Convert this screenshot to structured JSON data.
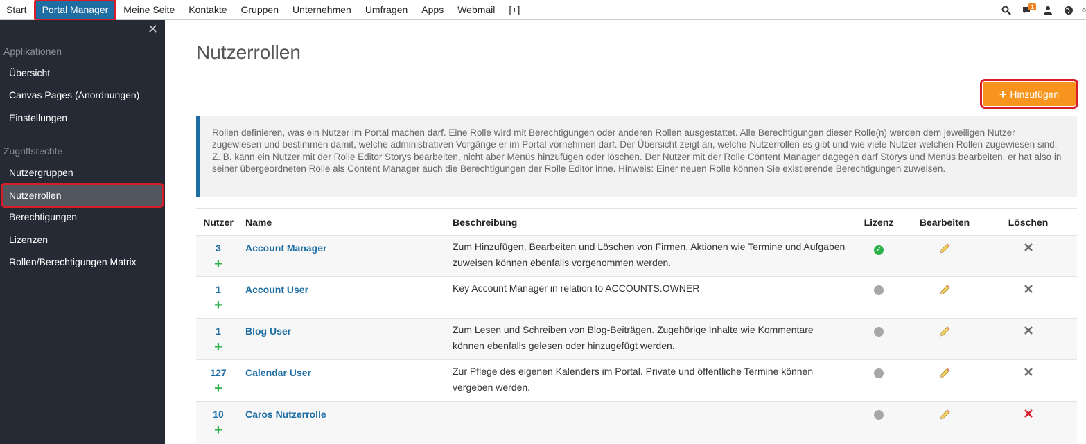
{
  "topnav": {
    "items": [
      "Start",
      "Portal Manager",
      "Meine Seite",
      "Kontakte",
      "Gruppen",
      "Unternehmen",
      "Umfragen",
      "Apps",
      "Webmail",
      "[+]"
    ],
    "active_index": 1,
    "notification_count": "1"
  },
  "sidebar": {
    "sections": [
      {
        "title": "Applikationen",
        "items": [
          "Übersicht",
          "Canvas Pages (Anordnungen)",
          "Einstellungen"
        ]
      },
      {
        "title": "Zugriffsrechte",
        "items": [
          "Nutzergruppen",
          "Nutzerrollen",
          "Berechtigungen",
          "Lizenzen",
          "Rollen/Berechtigungen Matrix"
        ]
      }
    ],
    "active_item": "Nutzerrollen"
  },
  "main": {
    "title": "Nutzerrollen",
    "add_button_label": "Hinzufügen",
    "info_text": "Rollen definieren, was ein Nutzer im Portal machen darf. Eine Rolle wird mit Berechtigungen oder anderen Rollen ausgestattet. Alle Berechtigungen dieser Rolle(n) werden dem jeweiligen Nutzer zugewiesen und bestimmen damit, welche administrativen Vorgänge er im Portal vornehmen darf. Der Übersicht zeigt an, welche Nutzerrollen es gibt und wie viele Nutzer welchen Rollen zugewiesen sind. Z. B. kann ein Nutzer mit der Rolle Editor Storys bearbeiten, nicht aber Menüs hinzufügen oder löschen. Der Nutzer mit der Rolle Content Manager dagegen darf Storys und Menüs bearbeiten, er hat also in seiner übergeordneten Rolle als Content Manager auch die Berechtigungen der Rolle Editor inne. Hinweis: Einer neuen Rolle können Sie existierende Berechtigungen zuweisen."
  },
  "table": {
    "headers": {
      "users": "Nutzer",
      "name": "Name",
      "description": "Beschreibung",
      "license": "Lizenz",
      "edit": "Bearbeiten",
      "delete": "Löschen"
    },
    "rows": [
      {
        "users": "3",
        "name": "Account Manager",
        "description": "Zum Hinzufügen, Bearbeiten und Löschen von Firmen. Aktionen wie Termine und Aufgaben zuweisen können ebenfalls vorgenommen werden.",
        "license": true,
        "delete_color": "#6b6b6b"
      },
      {
        "users": "1",
        "name": "Account User",
        "description": "Key Account Manager in relation to ACCOUNTS.OWNER",
        "license": false,
        "delete_color": "#6b6b6b"
      },
      {
        "users": "1",
        "name": "Blog User",
        "description": "Zum Lesen und Schreiben von Blog-Beiträgen. Zugehörige Inhalte wie Kommentare können ebenfalls gelesen oder hinzugefügt werden.",
        "license": false,
        "delete_color": "#6b6b6b"
      },
      {
        "users": "127",
        "name": "Calendar User",
        "description": "Zur Pflege des eigenen Kalenders im Portal. Private und öffentliche Termine können vergeben werden.",
        "license": false,
        "delete_color": "#6b6b6b"
      },
      {
        "users": "10",
        "name": "Caros Nutzerrolle",
        "description": "",
        "license": false,
        "delete_color": "#d71d28"
      }
    ]
  },
  "colors": {
    "accent": "#1e6ea4",
    "highlight": "#d71d28",
    "add_button": "#f7941d",
    "sidebar_bg": "#252a34",
    "license_on": "#2db14a",
    "license_off": "#a7a7a7"
  }
}
